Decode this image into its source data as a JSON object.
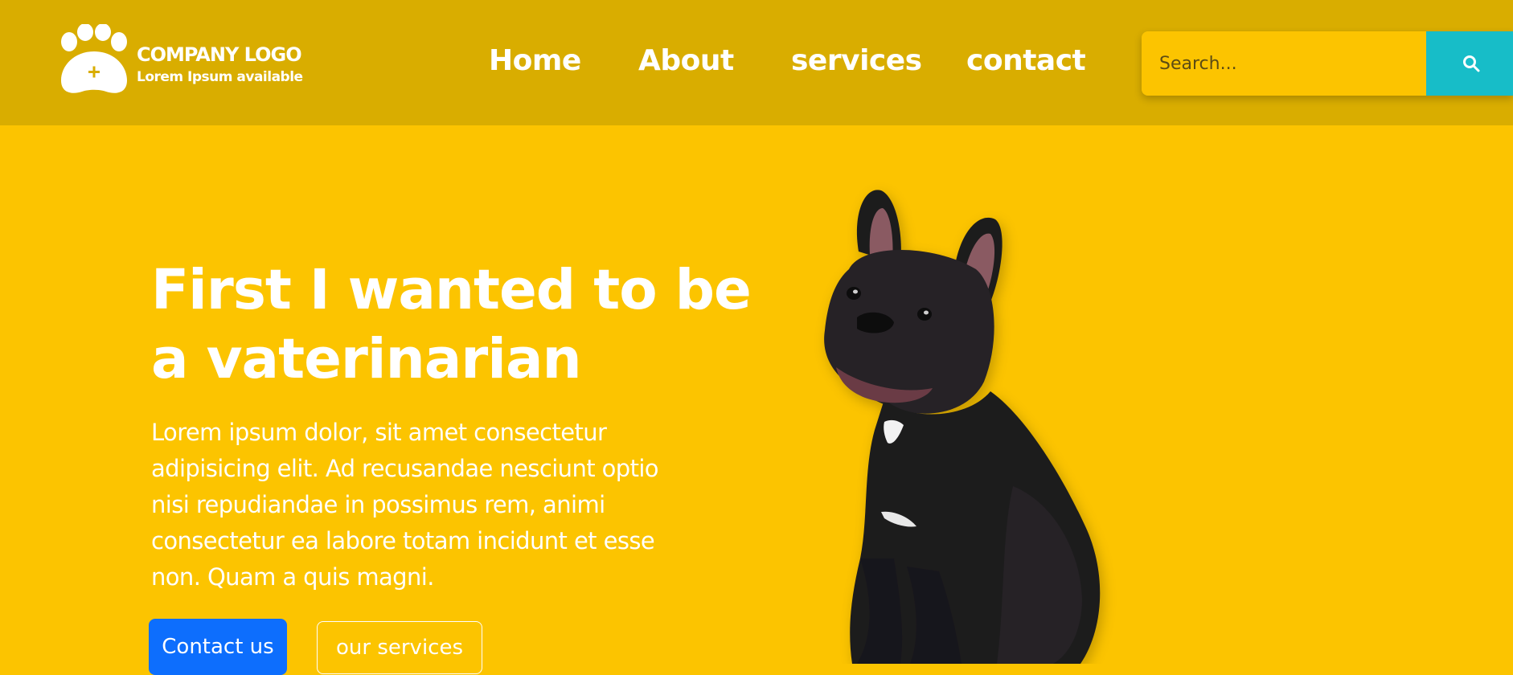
{
  "header": {
    "logo": {
      "title": "COMPANY LOGO",
      "subtitle": "Lorem Ipsum available",
      "icon": "paw-plus-icon"
    },
    "nav": [
      {
        "label": "Home"
      },
      {
        "label": "About"
      },
      {
        "label": "services"
      },
      {
        "label": "contact"
      }
    ],
    "search": {
      "placeholder": "Search...",
      "value": "",
      "button_icon": "search-icon"
    }
  },
  "hero": {
    "title_line1": "First I wanted to be",
    "title_line2": "a vaterinarian",
    "text": "Lorem ipsum dolor, sit amet consectetur adipisicing elit. Ad recusandae nesciunt optio nisi repudiandae in possimus rem, animi consectetur ea labore totam incidunt et esse non. Quam a quis magni.",
    "primary_button": "Contact us",
    "secondary_button": "our services",
    "image": "french-bulldog-image"
  },
  "colors": {
    "page_bg": "#fcc400",
    "header_bg": "#d9ad00",
    "search_button": "#17bdc8",
    "primary_button": "#0d6efd",
    "text": "#ffffff"
  }
}
